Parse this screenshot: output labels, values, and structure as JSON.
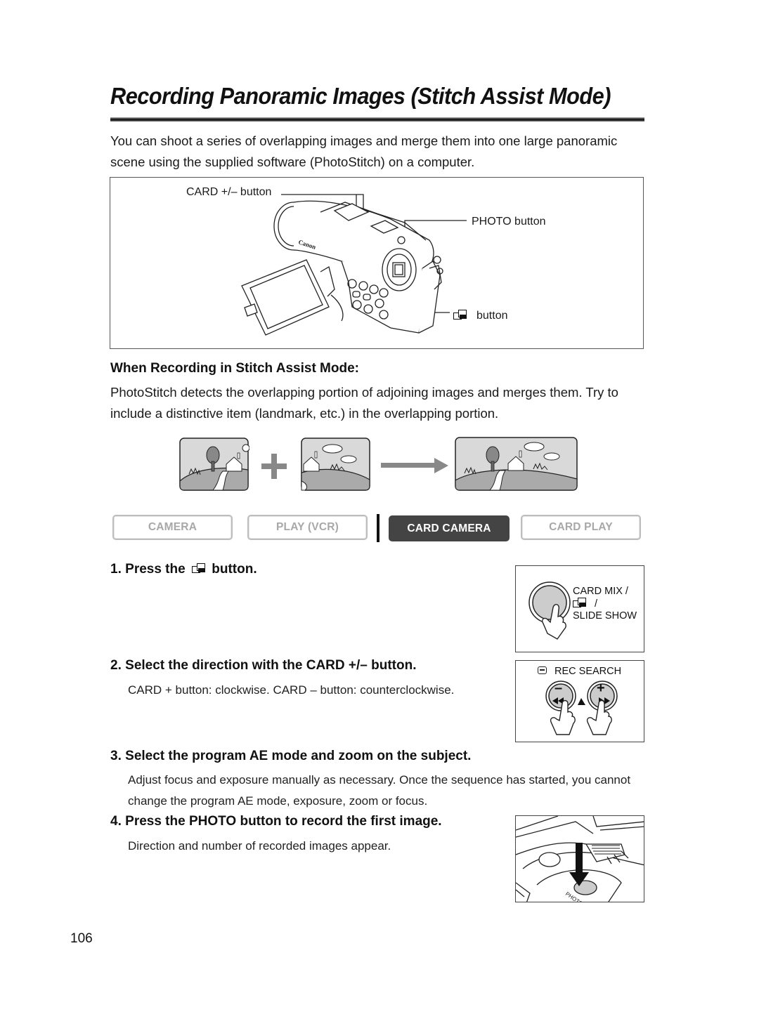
{
  "page": {
    "title": "Recording Panoramic Images (Stitch Assist Mode)",
    "intro": "You can shoot a series of overlapping images and merge them into one large panoramic scene using the supplied software (PhotoStitch) on a computer.",
    "page_number": "106"
  },
  "camera_figure": {
    "labels": {
      "card_button": "CARD +/– button",
      "photo_button": "PHOTO button",
      "stitch_button": "button"
    },
    "icons": [
      "camcorder-illustration",
      "stitch-assist-icon"
    ]
  },
  "stitch_section": {
    "heading": "When Recording in Stitch Assist Mode:",
    "body": "PhotoStitch detects the overlapping portion of adjoining images and merges them. Try to include a distinctive item (landmark, etc.) in the overlapping portion.",
    "diagram": {
      "images": [
        "left-scene-image",
        "right-scene-image",
        "merged-panorama-image"
      ],
      "operators": [
        "plus-icon",
        "arrow-right-icon"
      ]
    }
  },
  "mode_buttons": [
    {
      "label": "CAMERA",
      "active": false
    },
    {
      "label": "PLAY (VCR)",
      "active": false
    },
    {
      "label": "CARD CAMERA",
      "active": true
    },
    {
      "label": "CARD PLAY",
      "active": false
    }
  ],
  "steps": [
    {
      "number": "1.",
      "title_before": "Press the",
      "title_after": "button.",
      "body": ""
    },
    {
      "number": "2.",
      "title": "Select the direction with the CARD +/– button.",
      "body": "CARD + button: clockwise. CARD – button: counterclockwise."
    },
    {
      "number": "3.",
      "title": "Select the program AE mode and zoom on the subject.",
      "body": "Adjust focus and exposure manually as necessary. Once the sequence has started, you cannot change the program AE mode, exposure, zoom or focus."
    },
    {
      "number": "4.",
      "title": "Press the PHOTO button to record the first image.",
      "body": "Direction and number of recorded images appear."
    }
  ],
  "side_panels": {
    "card_mix": {
      "line1": "CARD MIX /",
      "line2": "/",
      "line3": "SLIDE SHOW"
    },
    "rec_search": {
      "label": "REC SEARCH",
      "minus": "–",
      "plus": "+"
    },
    "photo_closeup": {
      "label": "PHOTO"
    }
  }
}
